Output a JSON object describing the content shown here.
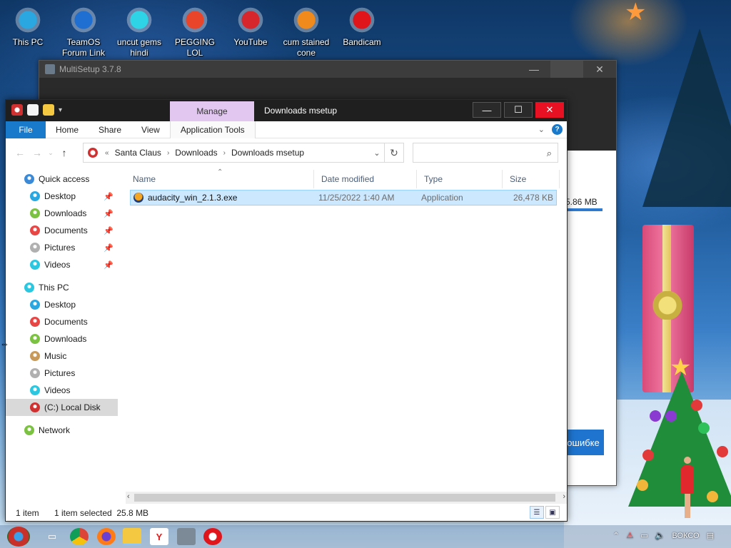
{
  "desktop": {
    "icons": [
      {
        "label": "This PC",
        "icon": "monitor-icon",
        "color": "#2aa6e0"
      },
      {
        "label": "TeamOS Forum Link",
        "icon": "gear-icon",
        "color": "#1e6fd1"
      },
      {
        "label": "uncut gems hindi",
        "icon": "diamond-icon",
        "color": "#2fd3e6"
      },
      {
        "label": "PEGGING LOL",
        "icon": "p-logo-icon",
        "color": "#e8452a"
      },
      {
        "label": "YouTube",
        "icon": "angry-bird-icon",
        "color": "#d7262c"
      },
      {
        "label": "cum stained cone",
        "icon": "traffic-cone-icon",
        "color": "#f08a1c"
      },
      {
        "label": "Bandicam",
        "icon": "record-icon",
        "color": "#e0151c"
      }
    ]
  },
  "bg_window": {
    "title": "MultiSetup 3.7.8",
    "size_label": "5.86 MB",
    "error_button": "ошибке"
  },
  "explorer": {
    "title": "Downloads msetup",
    "manage_tab": "Manage",
    "ribbon_tabs": [
      "File",
      "Home",
      "Share",
      "View",
      "Application Tools"
    ],
    "breadcrumb": [
      "Santa Claus",
      "Downloads",
      "Downloads msetup"
    ],
    "search_placeholder": "",
    "columns": {
      "name": "Name",
      "date": "Date modified",
      "type": "Type",
      "size": "Size"
    },
    "files": [
      {
        "name": "audacity_win_2.1.3.exe",
        "date": "11/25/2022 1:40 AM",
        "type": "Application",
        "size": "26,478 KB",
        "icon": "audacity-icon",
        "selected": true
      }
    ],
    "nav": {
      "quick_access": "Quick access",
      "quick_items": [
        "Desktop",
        "Downloads",
        "Documents",
        "Pictures",
        "Videos"
      ],
      "this_pc": "This PC",
      "pc_items": [
        "Desktop",
        "Documents",
        "Downloads",
        "Music",
        "Pictures",
        "Videos",
        "(C:) Local Disk"
      ],
      "network": "Network",
      "selected_item": "(C:) Local Disk"
    },
    "status": {
      "count": "1 item",
      "selection": "1 item selected  25.8 MB"
    },
    "window_controls": {
      "minimize": "—",
      "maximize": "☐",
      "close": "✕"
    }
  },
  "taskbar": {
    "apps": [
      "start-orb-icon",
      "task-view-icon",
      "chrome-icon",
      "firefox-icon",
      "file-explorer-icon",
      "yandex-icon",
      "multisetup-icon",
      "opera-icon"
    ],
    "tray_text": "ВОКСО"
  }
}
